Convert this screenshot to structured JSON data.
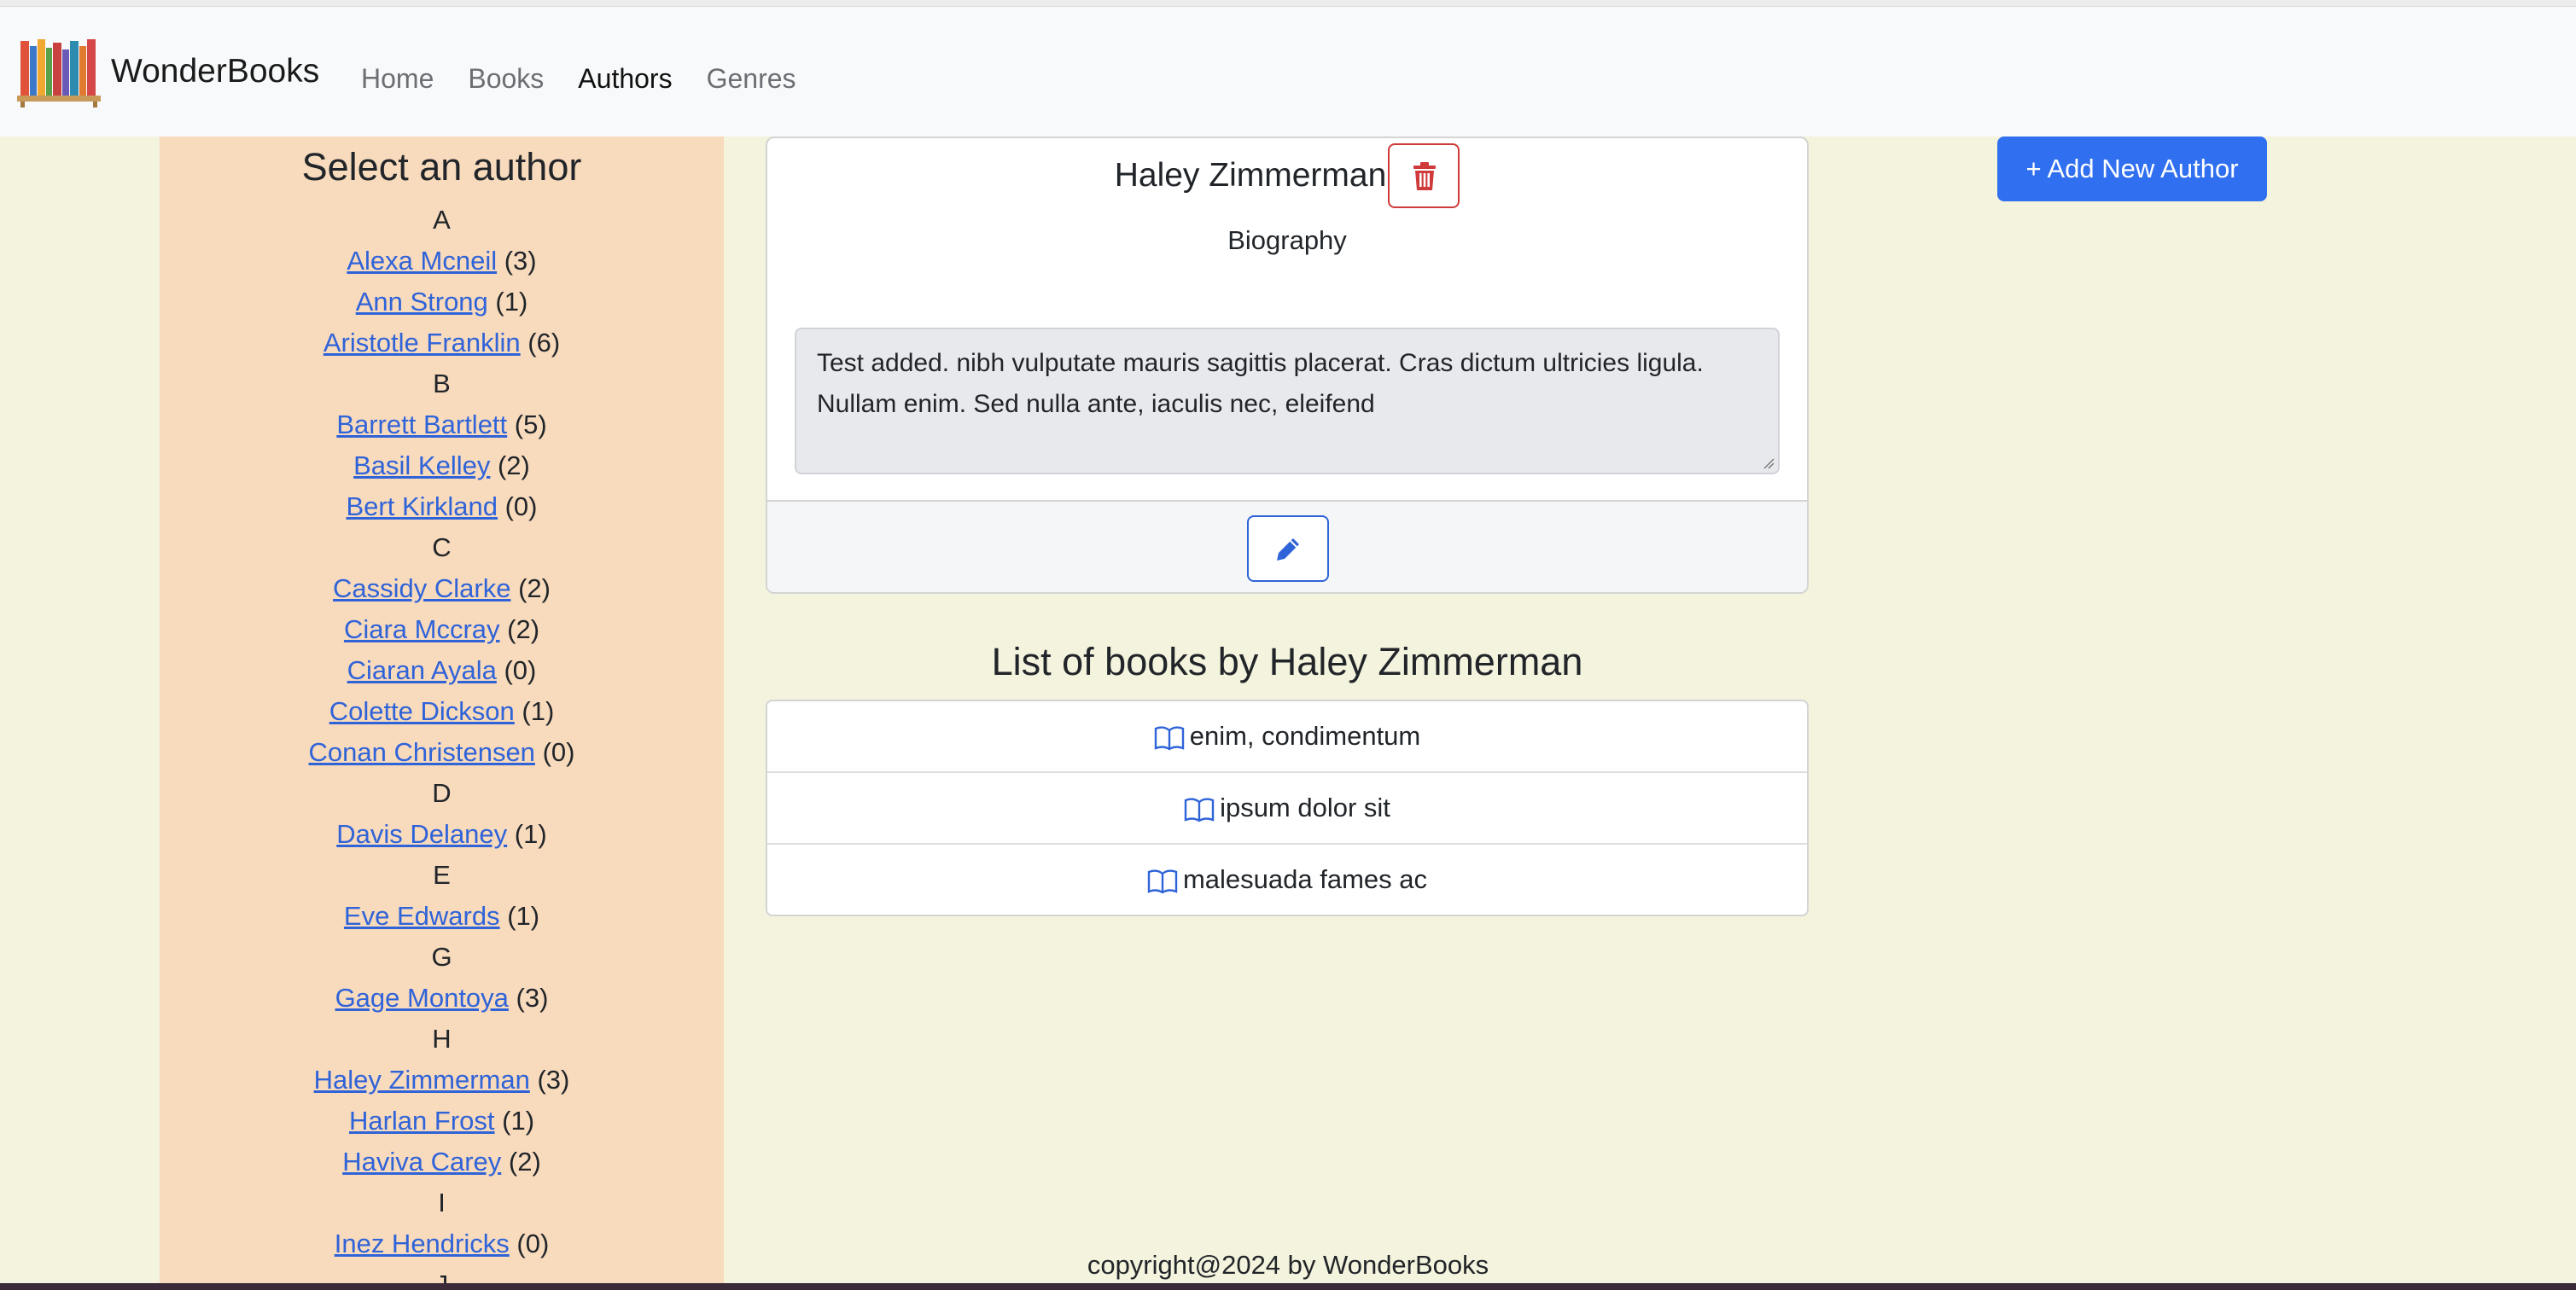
{
  "app": {
    "brand": "WonderBooks"
  },
  "nav": {
    "links": [
      {
        "label": "Home"
      },
      {
        "label": "Books"
      },
      {
        "label": "Authors"
      },
      {
        "label": "Genres"
      }
    ]
  },
  "sidebar": {
    "title": "Select an author",
    "groups": [
      {
        "letter": "A",
        "authors": [
          {
            "name": "Alexa Mcneil",
            "count": "(3)"
          },
          {
            "name": "Ann Strong",
            "count": "(1)"
          },
          {
            "name": "Aristotle Franklin",
            "count": "(6)"
          }
        ]
      },
      {
        "letter": "B",
        "authors": [
          {
            "name": "Barrett Bartlett",
            "count": "(5)"
          },
          {
            "name": "Basil Kelley",
            "count": "(2)"
          },
          {
            "name": "Bert Kirkland",
            "count": "(0)"
          }
        ]
      },
      {
        "letter": "C",
        "authors": [
          {
            "name": "Cassidy Clarke",
            "count": "(2)"
          },
          {
            "name": "Ciara Mccray",
            "count": "(2)"
          },
          {
            "name": "Ciaran Ayala",
            "count": "(0)"
          },
          {
            "name": "Colette Dickson",
            "count": "(1)"
          },
          {
            "name": "Conan Christensen",
            "count": "(0)"
          }
        ]
      },
      {
        "letter": "D",
        "authors": [
          {
            "name": "Davis Delaney",
            "count": "(1)"
          }
        ]
      },
      {
        "letter": "E",
        "authors": [
          {
            "name": "Eve Edwards",
            "count": "(1)"
          }
        ]
      },
      {
        "letter": "G",
        "authors": [
          {
            "name": "Gage Montoya",
            "count": "(3)"
          }
        ]
      },
      {
        "letter": "H",
        "authors": [
          {
            "name": "Haley Zimmerman",
            "count": "(3)"
          },
          {
            "name": "Harlan Frost",
            "count": "(1)"
          },
          {
            "name": "Haviva Carey",
            "count": "(2)"
          }
        ]
      },
      {
        "letter": "I",
        "authors": [
          {
            "name": "Inez Hendricks",
            "count": "(0)"
          }
        ]
      },
      {
        "letter": "J",
        "authors": []
      }
    ]
  },
  "author": {
    "name": "Haley Zimmerman",
    "bio_label": "Biography",
    "bio": "Test added. nibh vulputate mauris sagittis placerat. Cras dictum ultricies ligula. Nullam enim. Sed nulla ante, iaculis nec, eleifend"
  },
  "books": {
    "title": "List of books by Haley Zimmerman",
    "items": [
      {
        "title": "enim, condimentum"
      },
      {
        "title": "ipsum dolor sit"
      },
      {
        "title": "malesuada fames ac"
      }
    ]
  },
  "actions": {
    "add_author": "+ Add New Author"
  },
  "footer": {
    "text": "copyright@2024 by WonderBooks"
  },
  "colors": {
    "background": "#f4f3dd",
    "sidebar": "#f8dabd",
    "primary": "#2f6ff0",
    "link": "#2f63d8",
    "danger": "#d03a3a"
  },
  "icons": {
    "logo": "bookshelf-logo",
    "delete": "trash-icon",
    "edit": "pencil-icon",
    "book": "open-book-icon"
  }
}
